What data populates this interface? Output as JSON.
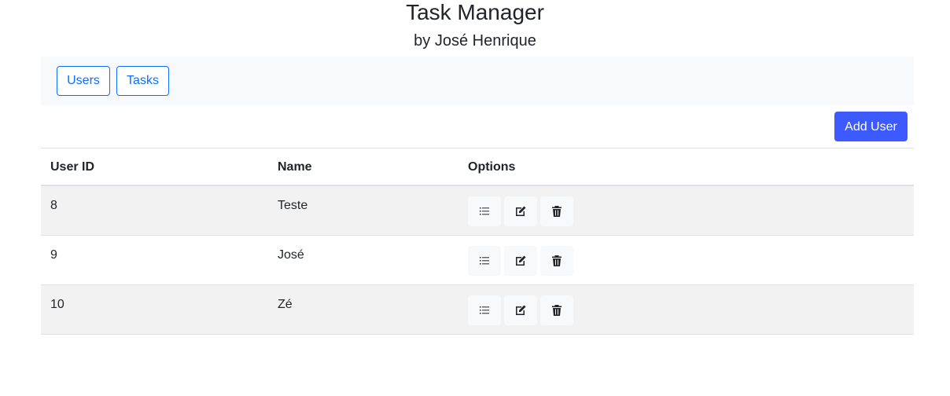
{
  "header": {
    "title": "Task Manager",
    "subtitle": "by José Henrique"
  },
  "nav": {
    "users_label": "Users",
    "tasks_label": "Tasks"
  },
  "toolbar": {
    "add_user_label": "Add User"
  },
  "table": {
    "columns": [
      "User ID",
      "Name",
      "Options"
    ],
    "rows": [
      {
        "id": "8",
        "name": "Teste"
      },
      {
        "id": "9",
        "name": "José"
      },
      {
        "id": "10",
        "name": "Zé"
      }
    ],
    "option_icons": [
      "list-icon",
      "edit-icon",
      "trash-icon"
    ]
  },
  "colors": {
    "primary": "#0d6efd",
    "add_button": "#3d5afe",
    "nav_background": "#f8f9fa",
    "stripe": "#f2f2f2"
  }
}
